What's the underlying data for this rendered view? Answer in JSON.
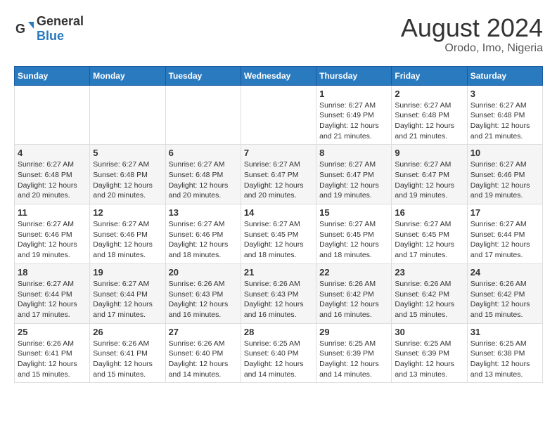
{
  "header": {
    "logo_general": "General",
    "logo_blue": "Blue",
    "main_title": "August 2024",
    "subtitle": "Orodo, Imo, Nigeria"
  },
  "calendar": {
    "days_of_week": [
      "Sunday",
      "Monday",
      "Tuesday",
      "Wednesday",
      "Thursday",
      "Friday",
      "Saturday"
    ],
    "weeks": [
      [
        {
          "day": "",
          "info": ""
        },
        {
          "day": "",
          "info": ""
        },
        {
          "day": "",
          "info": ""
        },
        {
          "day": "",
          "info": ""
        },
        {
          "day": "1",
          "info": "Sunrise: 6:27 AM\nSunset: 6:49 PM\nDaylight: 12 hours and 21 minutes."
        },
        {
          "day": "2",
          "info": "Sunrise: 6:27 AM\nSunset: 6:48 PM\nDaylight: 12 hours and 21 minutes."
        },
        {
          "day": "3",
          "info": "Sunrise: 6:27 AM\nSunset: 6:48 PM\nDaylight: 12 hours and 21 minutes."
        }
      ],
      [
        {
          "day": "4",
          "info": "Sunrise: 6:27 AM\nSunset: 6:48 PM\nDaylight: 12 hours and 20 minutes."
        },
        {
          "day": "5",
          "info": "Sunrise: 6:27 AM\nSunset: 6:48 PM\nDaylight: 12 hours and 20 minutes."
        },
        {
          "day": "6",
          "info": "Sunrise: 6:27 AM\nSunset: 6:48 PM\nDaylight: 12 hours and 20 minutes."
        },
        {
          "day": "7",
          "info": "Sunrise: 6:27 AM\nSunset: 6:47 PM\nDaylight: 12 hours and 20 minutes."
        },
        {
          "day": "8",
          "info": "Sunrise: 6:27 AM\nSunset: 6:47 PM\nDaylight: 12 hours and 19 minutes."
        },
        {
          "day": "9",
          "info": "Sunrise: 6:27 AM\nSunset: 6:47 PM\nDaylight: 12 hours and 19 minutes."
        },
        {
          "day": "10",
          "info": "Sunrise: 6:27 AM\nSunset: 6:46 PM\nDaylight: 12 hours and 19 minutes."
        }
      ],
      [
        {
          "day": "11",
          "info": "Sunrise: 6:27 AM\nSunset: 6:46 PM\nDaylight: 12 hours and 19 minutes."
        },
        {
          "day": "12",
          "info": "Sunrise: 6:27 AM\nSunset: 6:46 PM\nDaylight: 12 hours and 18 minutes."
        },
        {
          "day": "13",
          "info": "Sunrise: 6:27 AM\nSunset: 6:46 PM\nDaylight: 12 hours and 18 minutes."
        },
        {
          "day": "14",
          "info": "Sunrise: 6:27 AM\nSunset: 6:45 PM\nDaylight: 12 hours and 18 minutes."
        },
        {
          "day": "15",
          "info": "Sunrise: 6:27 AM\nSunset: 6:45 PM\nDaylight: 12 hours and 18 minutes."
        },
        {
          "day": "16",
          "info": "Sunrise: 6:27 AM\nSunset: 6:45 PM\nDaylight: 12 hours and 17 minutes."
        },
        {
          "day": "17",
          "info": "Sunrise: 6:27 AM\nSunset: 6:44 PM\nDaylight: 12 hours and 17 minutes."
        }
      ],
      [
        {
          "day": "18",
          "info": "Sunrise: 6:27 AM\nSunset: 6:44 PM\nDaylight: 12 hours and 17 minutes."
        },
        {
          "day": "19",
          "info": "Sunrise: 6:27 AM\nSunset: 6:44 PM\nDaylight: 12 hours and 17 minutes."
        },
        {
          "day": "20",
          "info": "Sunrise: 6:26 AM\nSunset: 6:43 PM\nDaylight: 12 hours and 16 minutes."
        },
        {
          "day": "21",
          "info": "Sunrise: 6:26 AM\nSunset: 6:43 PM\nDaylight: 12 hours and 16 minutes."
        },
        {
          "day": "22",
          "info": "Sunrise: 6:26 AM\nSunset: 6:42 PM\nDaylight: 12 hours and 16 minutes."
        },
        {
          "day": "23",
          "info": "Sunrise: 6:26 AM\nSunset: 6:42 PM\nDaylight: 12 hours and 15 minutes."
        },
        {
          "day": "24",
          "info": "Sunrise: 6:26 AM\nSunset: 6:42 PM\nDaylight: 12 hours and 15 minutes."
        }
      ],
      [
        {
          "day": "25",
          "info": "Sunrise: 6:26 AM\nSunset: 6:41 PM\nDaylight: 12 hours and 15 minutes."
        },
        {
          "day": "26",
          "info": "Sunrise: 6:26 AM\nSunset: 6:41 PM\nDaylight: 12 hours and 15 minutes."
        },
        {
          "day": "27",
          "info": "Sunrise: 6:26 AM\nSunset: 6:40 PM\nDaylight: 12 hours and 14 minutes."
        },
        {
          "day": "28",
          "info": "Sunrise: 6:25 AM\nSunset: 6:40 PM\nDaylight: 12 hours and 14 minutes."
        },
        {
          "day": "29",
          "info": "Sunrise: 6:25 AM\nSunset: 6:39 PM\nDaylight: 12 hours and 14 minutes."
        },
        {
          "day": "30",
          "info": "Sunrise: 6:25 AM\nSunset: 6:39 PM\nDaylight: 12 hours and 13 minutes."
        },
        {
          "day": "31",
          "info": "Sunrise: 6:25 AM\nSunset: 6:38 PM\nDaylight: 12 hours and 13 minutes."
        }
      ]
    ]
  }
}
